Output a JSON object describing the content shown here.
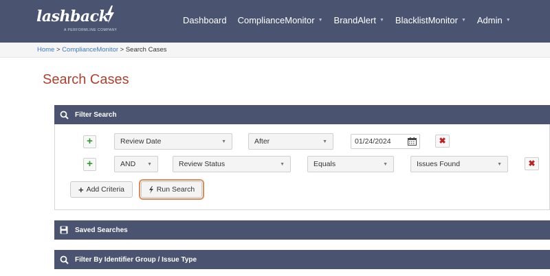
{
  "brand": {
    "name": "lashback",
    "tagline": "A PERFORMLINE COMPANY"
  },
  "nav": [
    {
      "label": "Dashboard",
      "caret": false
    },
    {
      "label": "ComplianceMonitor",
      "caret": true
    },
    {
      "label": "BrandAlert",
      "caret": true
    },
    {
      "label": "BlacklistMonitor",
      "caret": true
    },
    {
      "label": "Admin",
      "caret": true
    }
  ],
  "breadcrumb": {
    "home": "Home",
    "sep1": " > ",
    "section": "ComplianceMonitor",
    "sep2": " > ",
    "current": "Search Cases"
  },
  "page_title": "Search Cases",
  "filter_panel": {
    "title": "Filter Search",
    "row1": {
      "field": "Review Date",
      "operator": "After",
      "value": "01/24/2024"
    },
    "row2": {
      "conjunction": "AND",
      "field": "Review Status",
      "operator": "Equals",
      "value": "Issues Found"
    },
    "add_criteria_label": "Add Criteria",
    "run_search_label": "Run Search"
  },
  "saved_panel": {
    "title": "Saved Searches"
  },
  "identifier_panel": {
    "title": "Filter By Identifier Group / Issue Type"
  },
  "colors": {
    "navbar": "#4a5470",
    "title_accent": "#b04030",
    "link": "#3a7bbf",
    "add_green": "#2a9a2a",
    "remove_red": "#c02020",
    "focus_ring": "#e08a5a"
  }
}
